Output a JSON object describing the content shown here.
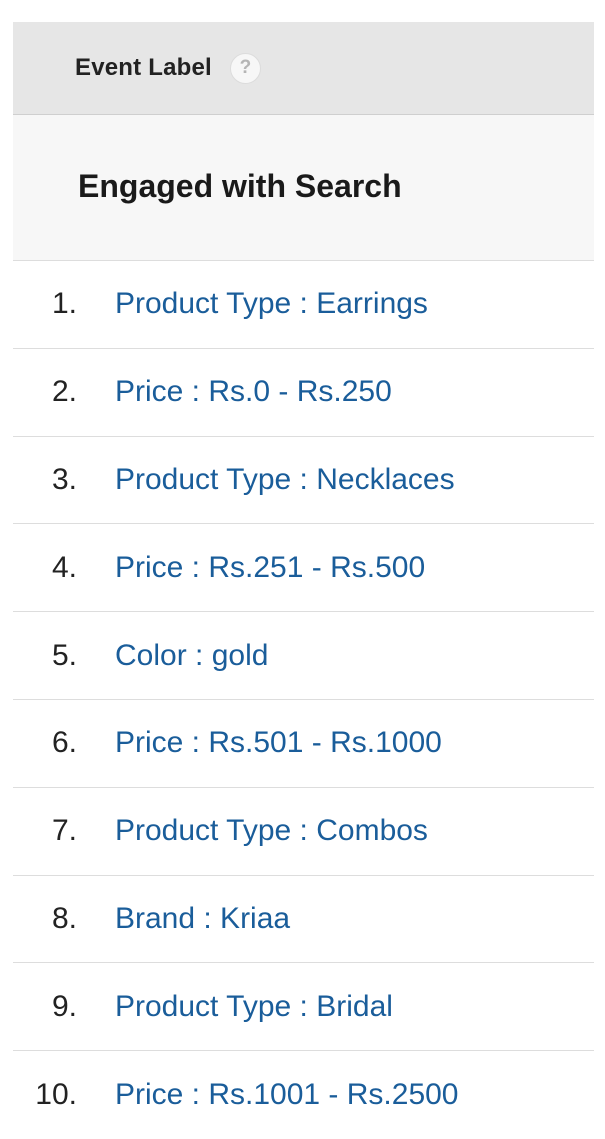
{
  "header": {
    "column_label": "Event Label",
    "help_glyph": "?"
  },
  "group": {
    "title": "Engaged with Search"
  },
  "rows": [
    {
      "index": "1.",
      "label": "Product Type : Earrings"
    },
    {
      "index": "2.",
      "label": "Price : Rs.0 - Rs.250"
    },
    {
      "index": "3.",
      "label": "Product Type : Necklaces"
    },
    {
      "index": "4.",
      "label": "Price : Rs.251 - Rs.500"
    },
    {
      "index": "5.",
      "label": "Color : gold"
    },
    {
      "index": "6.",
      "label": "Price : Rs.501 - Rs.1000"
    },
    {
      "index": "7.",
      "label": "Product Type : Combos"
    },
    {
      "index": "8.",
      "label": "Brand : Kriaa"
    },
    {
      "index": "9.",
      "label": "Product Type : Bridal"
    },
    {
      "index": "10.",
      "label": "Price : Rs.1001 - Rs.2500"
    }
  ],
  "colors": {
    "link": "#1a5d9a",
    "header_bg": "#e6e6e6",
    "group_bg": "#f7f7f7"
  }
}
